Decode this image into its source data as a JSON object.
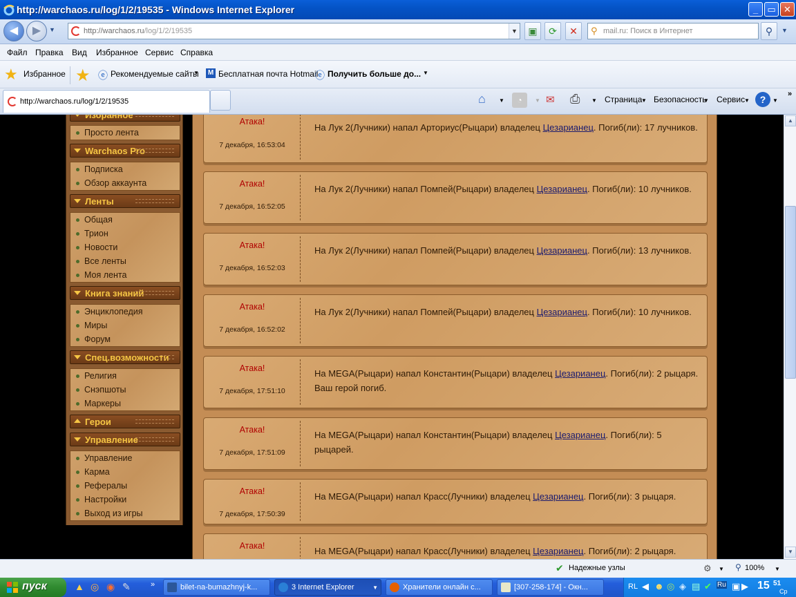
{
  "window": {
    "title": "http://warchaos.ru/log/1/2/19535 - Windows Internet Explorer",
    "min": "_",
    "max": "▭",
    "close": "✕"
  },
  "address": {
    "host": "http://warchaos.ru",
    "path": "/log/1/2/19535"
  },
  "search": {
    "placeholder": "mail.ru: Поиск в Интернет"
  },
  "menu": [
    "Файл",
    "Правка",
    "Вид",
    "Избранное",
    "Сервис",
    "Справка"
  ],
  "favorites": {
    "label": "Избранное",
    "links": [
      "Рекомендуемые сайты",
      "Бесплатная почта Hotmail",
      "Получить больше до..."
    ]
  },
  "tab": {
    "label": "http://warchaos.ru/log/1/2/19535"
  },
  "commands": {
    "page": "Страница",
    "safety": "Безопасность",
    "tools": "Сервис"
  },
  "sidebar": {
    "top_item": "Просто лента",
    "partial_header": "Избранное",
    "sections": [
      {
        "title": "Warchaos Pro",
        "expanded": true,
        "items": [
          "Подписка",
          "Обзор аккаунта"
        ]
      },
      {
        "title": "Ленты",
        "expanded": true,
        "items": [
          "Общая",
          "Трион",
          "Новости",
          "Все ленты",
          "Моя лента"
        ]
      },
      {
        "title": "Книга знаний",
        "expanded": true,
        "items": [
          "Энциклопедия",
          "Миры",
          "Форум"
        ]
      },
      {
        "title": "Спец.возможности",
        "expanded": true,
        "items": [
          "Религия",
          "Снэпшоты",
          "Маркеры"
        ]
      },
      {
        "title": "Герои",
        "expanded": false,
        "items": []
      },
      {
        "title": "Управление",
        "expanded": true,
        "items": [
          "Управление",
          "Карма",
          "Рефералы",
          "Настройки",
          "Выход из игры"
        ]
      }
    ]
  },
  "feed": [
    {
      "type": "Атака!",
      "time": "7 декабря, 16:53:04",
      "pre": "На Лук 2(Лучники) напал Арториус(Рыцари) владелец ",
      "owner": "Цезарианец",
      "post": ". Погиб(ли): 17 лучников."
    },
    {
      "type": "Атака!",
      "time": "7 декабря, 16:52:05",
      "pre": "На Лук 2(Лучники) напал Помпей(Рыцари) владелец ",
      "owner": "Цезарианец",
      "post": ". Погиб(ли): 10 лучников."
    },
    {
      "type": "Атака!",
      "time": "7 декабря, 16:52:03",
      "pre": "На Лук 2(Лучники) напал Помпей(Рыцари) владелец ",
      "owner": "Цезарианец",
      "post": ". Погиб(ли): 13 лучников."
    },
    {
      "type": "Атака!",
      "time": "7 декабря, 16:52:02",
      "pre": "На Лук 2(Лучники) напал Помпей(Рыцари) владелец ",
      "owner": "Цезарианец",
      "post": ". Погиб(ли): 10 лучников."
    },
    {
      "type": "Атака!",
      "time": "7 декабря, 17:51:10",
      "pre": "На MEGA(Рыцари) напал Константин(Рыцари) владелец ",
      "owner": "Цезарианец",
      "post": ". Погиб(ли): 2 рыцаря. Ваш герой погиб."
    },
    {
      "type": "Атака!",
      "time": "7 декабря, 17:51:09",
      "pre": "На MEGA(Рыцари) напал Константин(Рыцари) владелец ",
      "owner": "Цезарианец",
      "post": ". Погиб(ли): 5 рыцарей."
    },
    {
      "type": "Атака!",
      "time": "7 декабря, 17:50:39",
      "pre": "На MEGA(Рыцари) напал Красс(Лучники) владелец ",
      "owner": "Цезарианец",
      "post": ". Погиб(ли): 3 рыцаря."
    },
    {
      "type": "Атака!",
      "time": "",
      "pre": "На MEGA(Рыцари) напал Красс(Лучники) владелец ",
      "owner": "Цезарианец",
      "post": ". Погиб(ли): 2 рыцаря."
    }
  ],
  "status": {
    "zone": "Надежные узлы",
    "zoom": "100%"
  },
  "taskbar": {
    "start": "пуск",
    "buttons": [
      {
        "label": "bilet-na-bumazhnyj-k...",
        "active": false
      },
      {
        "label": "3 Internet Explorer",
        "active": true
      },
      {
        "label": "Хранители онлайн с...",
        "active": false
      },
      {
        "label": "[307-258-174] - Окн...",
        "active": false
      }
    ],
    "lang": "RL",
    "clock_h": "15",
    "clock_m": "51",
    "day": "Ср"
  }
}
